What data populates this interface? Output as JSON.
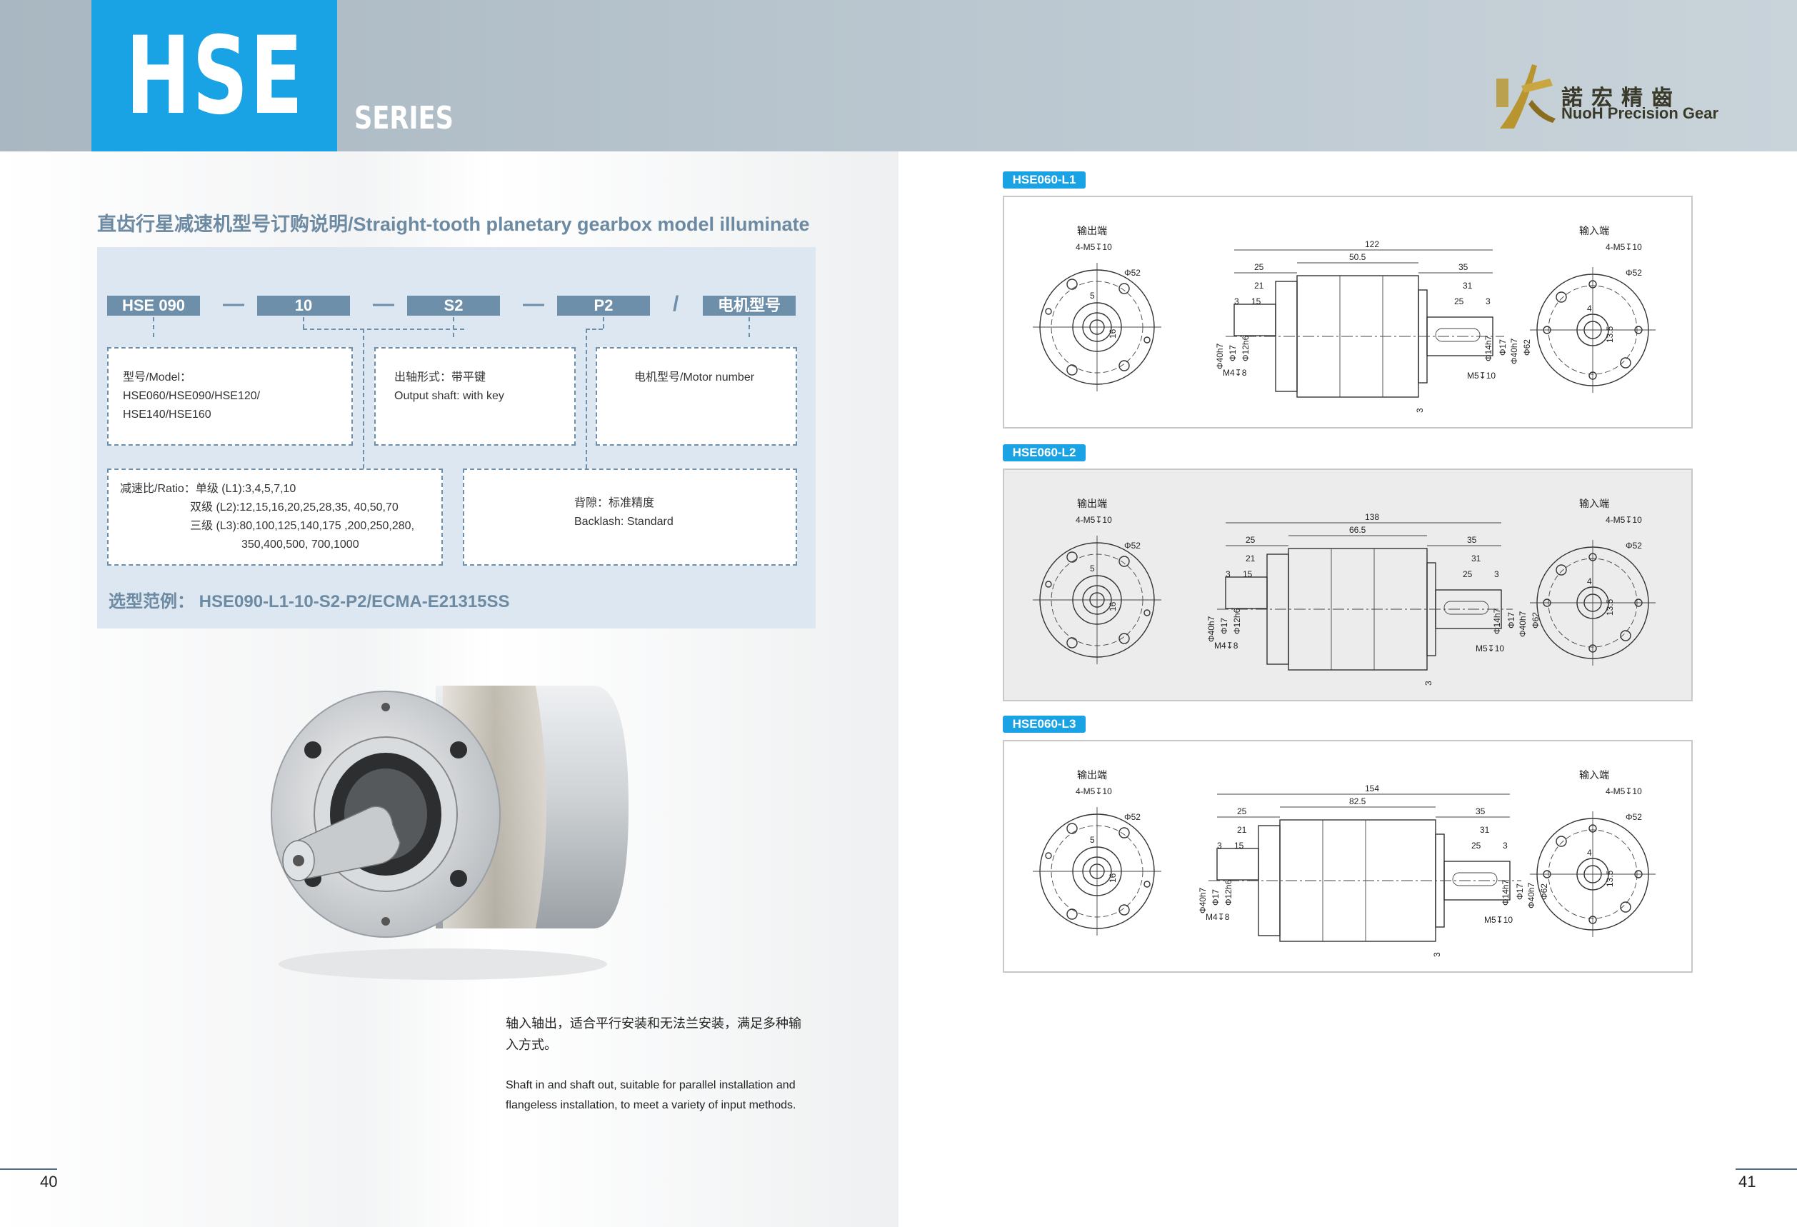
{
  "header": {
    "series_code": "HSE",
    "series_word": "SERIES",
    "brand_cn": "諾宏精齒",
    "brand_en": "NuoH Precision Gear"
  },
  "model_guide": {
    "title": "直齿行星减速机型号订购说明/Straight-tooth planetary gearbox model illuminate",
    "code_parts": [
      "HSE 090",
      "10",
      "S2",
      "P2",
      "电机型号"
    ],
    "separators": [
      "—",
      "—",
      "—",
      "/"
    ],
    "model_box": {
      "label": "型号/Model：",
      "lines": [
        "HSE060/HSE090/HSE120/",
        "HSE140/HSE160"
      ]
    },
    "shaft_box": {
      "label": "出轴形式：带平键",
      "line": "Output shaft: with key"
    },
    "motor_box": {
      "label": "电机型号/Motor number"
    },
    "ratio_box": {
      "label": "减速比/Ratio：",
      "lines": [
        "单级 (L1):3,4,5,7,10",
        "双级 (L2):12,15,16,20,25,28,35, 40,50,70",
        "三级 (L3):80,100,125,140,175 ,200,250,280,",
        "350,400,500, 700,1000"
      ]
    },
    "backlash_box": {
      "label": "背隙：标准精度",
      "line": "Backlash: Standard"
    },
    "example": "选型范例： HSE090-L1-10-S2-P2/ECMA-E21315SS"
  },
  "description": {
    "cn": "轴入轴出，适合平行安装和无法兰安装，满足多种输入方式。",
    "en": "Shaft in and shaft out, suitable for parallel installation and flangeless installation, to meet a variety of input methods."
  },
  "page_numbers": {
    "left": "40",
    "right": "41"
  },
  "drawings": [
    {
      "tag": "HSE060-L1",
      "total": "122",
      "body": "50.5"
    },
    {
      "tag": "HSE060-L2",
      "total": "138",
      "body": "66.5"
    },
    {
      "tag": "HSE060-L3",
      "total": "154",
      "body": "82.5"
    }
  ],
  "drawing_common": {
    "output_end": "输出端",
    "input_end": "输入端",
    "bolt": "4-M5↧10",
    "phi52": "Φ52",
    "d25": "25",
    "d21": "21",
    "d3": "3",
    "d15": "15",
    "d35": "35",
    "d31": "31",
    "d25b": "25",
    "d3b": "3",
    "phi40": "Φ40h7",
    "phi17": "Φ17",
    "phi12": "Φ12h6",
    "m4": "M4↧8",
    "phi14": "Φ14h7",
    "phi17b": "Φ17",
    "phi40b": "Φ40h7",
    "phi62": "Φ62",
    "m5": "M5↧10",
    "d16": "16",
    "d4": "4",
    "d135": "13.5",
    "d5": "5",
    "d3c": "3"
  }
}
